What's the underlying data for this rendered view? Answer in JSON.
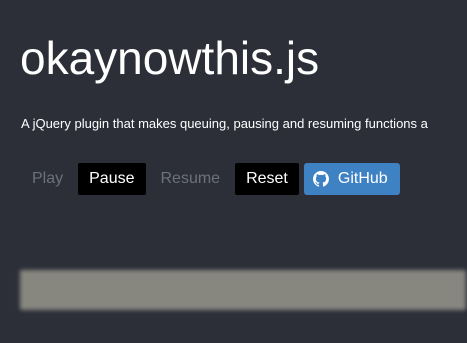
{
  "page": {
    "title": "okaynowthis.js",
    "description": "A jQuery plugin that makes queuing, pausing and resuming functions a"
  },
  "controls": {
    "play_label": "Play",
    "pause_label": "Pause",
    "resume_label": "Resume",
    "reset_label": "Reset",
    "github_label": "GitHub",
    "github_icon": "github-icon"
  },
  "colors": {
    "background": "#2c2f38",
    "active_button": "#000000",
    "github_button": "#3f82c4",
    "disabled_text": "#6d717b",
    "output_box": "#878780"
  }
}
